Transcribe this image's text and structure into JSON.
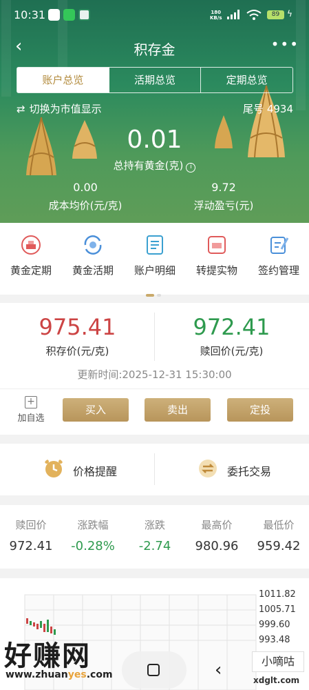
{
  "status_bar": {
    "time": "10:31",
    "net_speed": "180",
    "net_unit": "KB/s",
    "battery": "89"
  },
  "header": {
    "title": "积存金"
  },
  "tabs": [
    {
      "label": "账户总览",
      "active": true
    },
    {
      "label": "活期总览",
      "active": false
    },
    {
      "label": "定期总览",
      "active": false
    }
  ],
  "overview": {
    "switch_label": "切换为市值显示",
    "account_tail": "尾号 4934",
    "total_value": "0.01",
    "total_label": "总持有黄金(克)",
    "cost_value": "0.00",
    "cost_label": "成本均价(元/克)",
    "pnl_value": "9.72",
    "pnl_label": "浮动盈亏(元)"
  },
  "quick_menu": [
    {
      "label": "黄金定期",
      "icon": "gold-bar-icon",
      "color": "#e05a5a"
    },
    {
      "label": "黄金活期",
      "icon": "refresh-coin-icon",
      "color": "#4a8fd9"
    },
    {
      "label": "账户明细",
      "icon": "document-icon",
      "color": "#3aa0d0"
    },
    {
      "label": "转提实物",
      "icon": "gift-box-icon",
      "color": "#e05a5a"
    },
    {
      "label": "签约管理",
      "icon": "edit-document-icon",
      "color": "#4a8fd9"
    }
  ],
  "prices": {
    "buy_price": "975.41",
    "buy_label": "积存价(元/克)",
    "sell_price": "972.41",
    "sell_label": "赎回价(元/克)",
    "updated": "更新时间:2025-12-31 15:30:00"
  },
  "actions": {
    "watch_label": "加自选",
    "buy": "买入",
    "sell": "卖出",
    "plan": "定投"
  },
  "tools": {
    "alert": "价格提醒",
    "entrust": "委托交易"
  },
  "quote": [
    {
      "label": "赎回价",
      "value": "972.41",
      "color": "#333333"
    },
    {
      "label": "涨跌幅",
      "value": "-0.28%",
      "color": "#2e9a4e"
    },
    {
      "label": "涨跌",
      "value": "-2.74",
      "color": "#2e9a4e"
    },
    {
      "label": "最高价",
      "value": "980.96",
      "color": "#333333"
    },
    {
      "label": "最低价",
      "value": "959.42",
      "color": "#333333"
    }
  ],
  "chart_axis": [
    "1011.82",
    "1005.71",
    "999.60",
    "993.48"
  ],
  "watermark": {
    "text": "好赚网",
    "url_a": "www.zhuan",
    "url_b": "yes",
    "url_c": ".com",
    "badge": "小嘀咕",
    "badge_url": "xdglt.com"
  },
  "colors": {
    "gold": "#b8955b",
    "red": "#cc4444",
    "green": "#2e9a4e"
  }
}
